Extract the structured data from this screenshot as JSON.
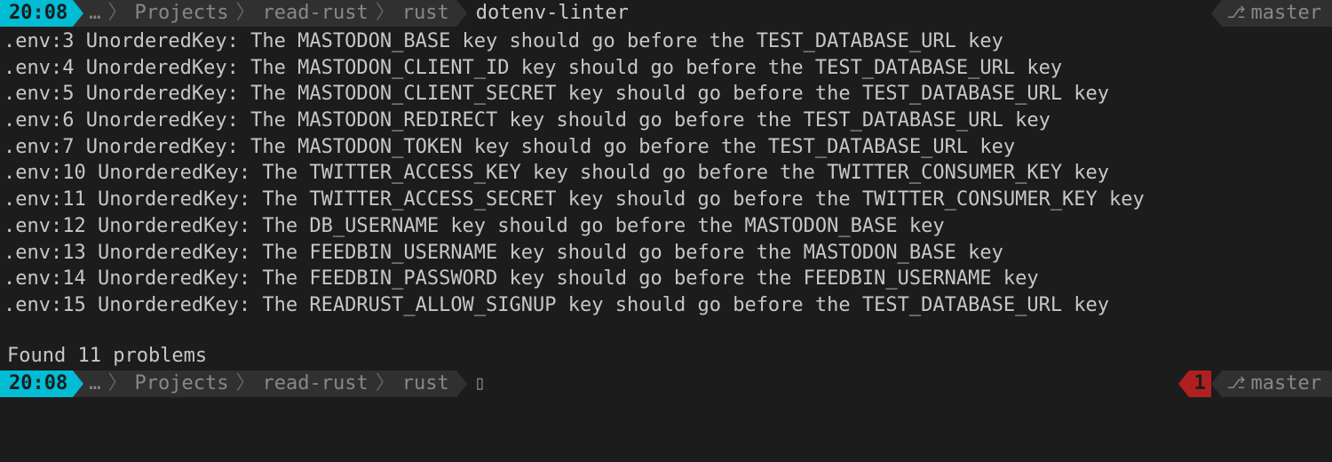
{
  "prompt1": {
    "time": "20:08",
    "ellipsis": "…",
    "path": [
      "Projects",
      "read-rust",
      "rust"
    ],
    "current": "dotenv-linter",
    "git_branch": "master"
  },
  "output": [
    ".env:3 UnorderedKey: The MASTODON_BASE key should go before the TEST_DATABASE_URL key",
    ".env:4 UnorderedKey: The MASTODON_CLIENT_ID key should go before the TEST_DATABASE_URL key",
    ".env:5 UnorderedKey: The MASTODON_CLIENT_SECRET key should go before the TEST_DATABASE_URL key",
    ".env:6 UnorderedKey: The MASTODON_REDIRECT key should go before the TEST_DATABASE_URL key",
    ".env:7 UnorderedKey: The MASTODON_TOKEN key should go before the TEST_DATABASE_URL key",
    ".env:10 UnorderedKey: The TWITTER_ACCESS_KEY key should go before the TWITTER_CONSUMER_KEY key",
    ".env:11 UnorderedKey: The TWITTER_ACCESS_SECRET key should go before the TWITTER_CONSUMER_KEY key",
    ".env:12 UnorderedKey: The DB_USERNAME key should go before the MASTODON_BASE key",
    ".env:13 UnorderedKey: The FEEDBIN_USERNAME key should go before the MASTODON_BASE key",
    ".env:14 UnorderedKey: The FEEDBIN_PASSWORD key should go before the FEEDBIN_USERNAME key",
    ".env:15 UnorderedKey: The READRUST_ALLOW_SIGNUP key should go before the TEST_DATABASE_URL key"
  ],
  "summary": "Found 11 problems",
  "prompt2": {
    "time": "20:08",
    "ellipsis": "…",
    "path": [
      "Projects",
      "read-rust",
      "rust"
    ],
    "cursor": "▯",
    "error_code": "1",
    "git_branch": "master"
  }
}
